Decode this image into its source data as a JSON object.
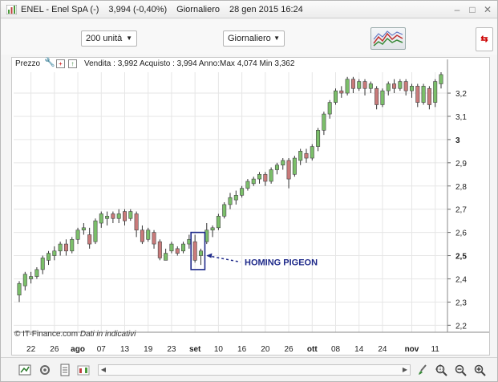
{
  "window": {
    "title_name": "ENEL - Enel SpA (-)",
    "title_price": "3,994 (-0,40%)",
    "title_period": "Giornaliero",
    "title_date": "28 gen 2015 16:24",
    "minimize": "–",
    "maximize": "□",
    "close": "✕"
  },
  "toolbar": {
    "units_select": "200 unità",
    "period_select": "Giornaliero",
    "indicator_icon": "indicator-chart-icon",
    "side_button_icon": "share-arrow-icon"
  },
  "chart_header": {
    "label": "Prezzo",
    "values": "Vendita : 3,992 Acquisto : 3,994 Anno:Max 4,074 Min 3,362"
  },
  "watermark": {
    "source": "© IT-Finance.com",
    "note": "Dati in indicativi"
  },
  "annotation": {
    "text": "HOMING PIGEON",
    "color": "#1f2a8a"
  },
  "colors": {
    "up": "#7bbf6a",
    "down": "#c97a7a",
    "wick": "#333333",
    "grid": "#e6e6e6"
  },
  "chart_data": {
    "type": "candlestick",
    "x_tick_labels": [
      "22",
      "26",
      "ago",
      "07",
      "13",
      "19",
      "23",
      "set",
      "10",
      "16",
      "20",
      "26",
      "ott",
      "08",
      "14",
      "24",
      "nov",
      "11"
    ],
    "y_tick_labels": [
      "3,2",
      "3,1",
      "3",
      "2,9",
      "2,8",
      "2,7",
      "2,6",
      "2,5",
      "2,4",
      "2,3",
      "2,2"
    ],
    "y_ticks": [
      3.2,
      3.1,
      3.0,
      2.9,
      2.8,
      2.7,
      2.6,
      2.5,
      2.4,
      2.3,
      2.2
    ],
    "ylim": [
      2.17,
      3.29
    ],
    "grid": true,
    "candles": [
      [
        2.33,
        2.38,
        2.3,
        2.39
      ],
      [
        2.37,
        2.42,
        2.35,
        2.43
      ],
      [
        2.4,
        2.41,
        2.38,
        2.43
      ],
      [
        2.41,
        2.44,
        2.4,
        2.45
      ],
      [
        2.44,
        2.49,
        2.42,
        2.5
      ],
      [
        2.48,
        2.51,
        2.46,
        2.52
      ],
      [
        2.5,
        2.52,
        2.48,
        2.54
      ],
      [
        2.52,
        2.55,
        2.5,
        2.56
      ],
      [
        2.55,
        2.52,
        2.5,
        2.57
      ],
      [
        2.52,
        2.57,
        2.51,
        2.58
      ],
      [
        2.57,
        2.61,
        2.55,
        2.62
      ],
      [
        2.61,
        2.62,
        2.59,
        2.64
      ],
      [
        2.59,
        2.55,
        2.53,
        2.62
      ],
      [
        2.56,
        2.65,
        2.55,
        2.66
      ],
      [
        2.64,
        2.68,
        2.62,
        2.69
      ],
      [
        2.66,
        2.67,
        2.63,
        2.69
      ],
      [
        2.68,
        2.66,
        2.64,
        2.69
      ],
      [
        2.66,
        2.68,
        2.64,
        2.7
      ],
      [
        2.69,
        2.65,
        2.63,
        2.7
      ],
      [
        2.66,
        2.69,
        2.65,
        2.7
      ],
      [
        2.68,
        2.61,
        2.58,
        2.69
      ],
      [
        2.61,
        2.56,
        2.55,
        2.63
      ],
      [
        2.57,
        2.61,
        2.56,
        2.62
      ],
      [
        2.6,
        2.55,
        2.53,
        2.61
      ],
      [
        2.56,
        2.49,
        2.48,
        2.57
      ],
      [
        2.48,
        2.51,
        2.48,
        2.53
      ],
      [
        2.52,
        2.55,
        2.51,
        2.56
      ],
      [
        2.53,
        2.51,
        2.5,
        2.54
      ],
      [
        2.52,
        2.55,
        2.51,
        2.56
      ],
      [
        2.55,
        2.57,
        2.53,
        2.59
      ],
      [
        2.56,
        2.48,
        2.47,
        2.59
      ],
      [
        2.5,
        2.52,
        2.46,
        2.53
      ],
      [
        2.56,
        2.61,
        2.55,
        2.64
      ],
      [
        2.61,
        2.62,
        2.58,
        2.63
      ],
      [
        2.62,
        2.67,
        2.61,
        2.68
      ],
      [
        2.67,
        2.72,
        2.66,
        2.73
      ],
      [
        2.72,
        2.75,
        2.7,
        2.77
      ],
      [
        2.74,
        2.76,
        2.72,
        2.78
      ],
      [
        2.76,
        2.79,
        2.75,
        2.8
      ],
      [
        2.79,
        2.82,
        2.78,
        2.83
      ],
      [
        2.81,
        2.83,
        2.8,
        2.84
      ],
      [
        2.83,
        2.85,
        2.81,
        2.86
      ],
      [
        2.85,
        2.82,
        2.8,
        2.86
      ],
      [
        2.82,
        2.87,
        2.81,
        2.88
      ],
      [
        2.87,
        2.89,
        2.85,
        2.9
      ],
      [
        2.89,
        2.91,
        2.87,
        2.92
      ],
      [
        2.91,
        2.83,
        2.79,
        2.92
      ],
      [
        2.85,
        2.92,
        2.84,
        2.93
      ],
      [
        2.91,
        2.95,
        2.89,
        2.96
      ],
      [
        2.94,
        2.92,
        2.9,
        2.96
      ],
      [
        2.92,
        2.97,
        2.91,
        2.98
      ],
      [
        2.97,
        3.04,
        2.95,
        3.05
      ],
      [
        3.04,
        3.11,
        3.02,
        3.12
      ],
      [
        3.11,
        3.16,
        3.09,
        3.17
      ],
      [
        3.16,
        3.21,
        3.15,
        3.22
      ],
      [
        3.21,
        3.2,
        3.18,
        3.23
      ],
      [
        3.2,
        3.26,
        3.19,
        3.27
      ],
      [
        3.26,
        3.22,
        3.2,
        3.27
      ],
      [
        3.22,
        3.25,
        3.21,
        3.26
      ],
      [
        3.25,
        3.22,
        3.19,
        3.26
      ],
      [
        3.22,
        3.24,
        3.2,
        3.25
      ],
      [
        3.22,
        3.15,
        3.13,
        3.23
      ],
      [
        3.15,
        3.21,
        3.14,
        3.22
      ],
      [
        3.21,
        3.24,
        3.19,
        3.25
      ],
      [
        3.24,
        3.22,
        3.2,
        3.26
      ],
      [
        3.22,
        3.25,
        3.21,
        3.26
      ],
      [
        3.25,
        3.21,
        3.19,
        3.26
      ],
      [
        3.21,
        3.23,
        3.18,
        3.24
      ],
      [
        3.23,
        3.16,
        3.14,
        3.24
      ],
      [
        3.16,
        3.23,
        3.15,
        3.24
      ],
      [
        3.22,
        3.15,
        3.13,
        3.23
      ],
      [
        3.16,
        3.25,
        3.14,
        3.26
      ],
      [
        3.24,
        3.28,
        3.22,
        3.29
      ]
    ],
    "annotated_candles": [
      30,
      31
    ]
  }
}
